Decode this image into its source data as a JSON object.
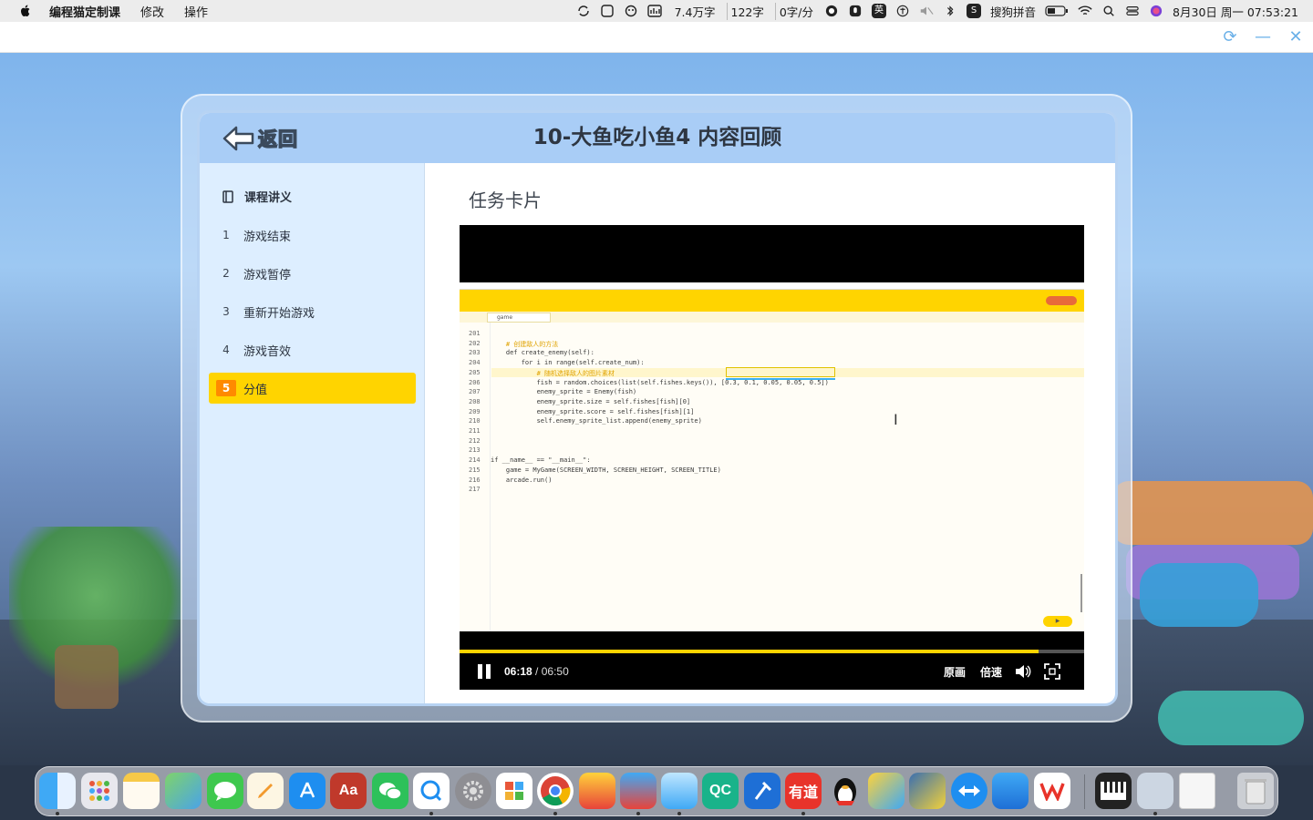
{
  "menubar": {
    "app_name": "编程猫定制课",
    "menus": [
      "修改",
      "操作"
    ],
    "stats": [
      "7.4万字",
      "122字",
      "0字/分"
    ],
    "ime_label": "英",
    "sogou_label": "搜狗拼音",
    "datetime": "8月30日 周一  07:53:21"
  },
  "panel": {
    "back_label": "返回",
    "title": "10-大鱼吃小鱼4 内容回顾"
  },
  "sidebar": {
    "header": "课程讲义",
    "items": [
      {
        "num": "1",
        "label": "游戏结束"
      },
      {
        "num": "2",
        "label": "游戏暂停"
      },
      {
        "num": "3",
        "label": "重新开始游戏"
      },
      {
        "num": "4",
        "label": "游戏音效"
      },
      {
        "num": "5",
        "label": "分值",
        "active": true
      }
    ]
  },
  "content": {
    "title": "任务卡片"
  },
  "ide": {
    "tab_label": "game",
    "line_numbers": [
      "201",
      "202",
      "203",
      "204",
      "205",
      "206",
      "207",
      "208",
      "209",
      "210",
      "211",
      "212",
      "213",
      "214",
      "215",
      "216",
      "217"
    ],
    "lines": [
      "",
      "    # 创建敌人的方法",
      "    def create_enemy(self):",
      "        for i in range(self.create_num):",
      "            # 随机选择敌人的图片素材",
      "            fish = random.choices(list(self.fishes.keys()), [0.3, 0.1, 0.05, 0.05, 0.5])",
      "            enemy_sprite = Enemy(fish)",
      "            enemy_sprite.size = self.fishes[fish][0]",
      "            enemy_sprite.score = self.fishes[fish][1]",
      "            self.enemy_sprite_list.append(enemy_sprite)",
      "",
      "",
      "",
      "if __name__ == \"__main__\":",
      "    game = MyGame(SCREEN_WIDTH, SCREEN_HEIGHT, SCREEN_TITLE)",
      "    arcade.run()",
      ""
    ]
  },
  "player": {
    "current_time": "06:18",
    "total_time": "06:50",
    "progress": 0.927,
    "quality_label": "原画",
    "speed_label": "倍速"
  },
  "colors": {
    "accent_yellow": "#ffd400",
    "active_num": "#ff8a00",
    "header_blue": "#a9cdf6",
    "sidebar_bg": "#ddeeff"
  },
  "dock": {
    "apps": [
      "finder",
      "launchpad",
      "notes",
      "maps",
      "messages",
      "pages",
      "app-store",
      "dictionary",
      "wechat",
      "qq-browser",
      "system-prefs",
      "paint",
      "chrome",
      "codemao-1",
      "codemao-2",
      "codemao-3",
      "qc",
      "xcode",
      "youdao",
      "qq",
      "kiko",
      "python",
      "teamviewer",
      "keynote",
      "wps",
      "piano",
      "preview",
      "document",
      "trash"
    ],
    "label_dictionary": "Aa",
    "label_qc": "QC",
    "label_youdao": "有道"
  }
}
